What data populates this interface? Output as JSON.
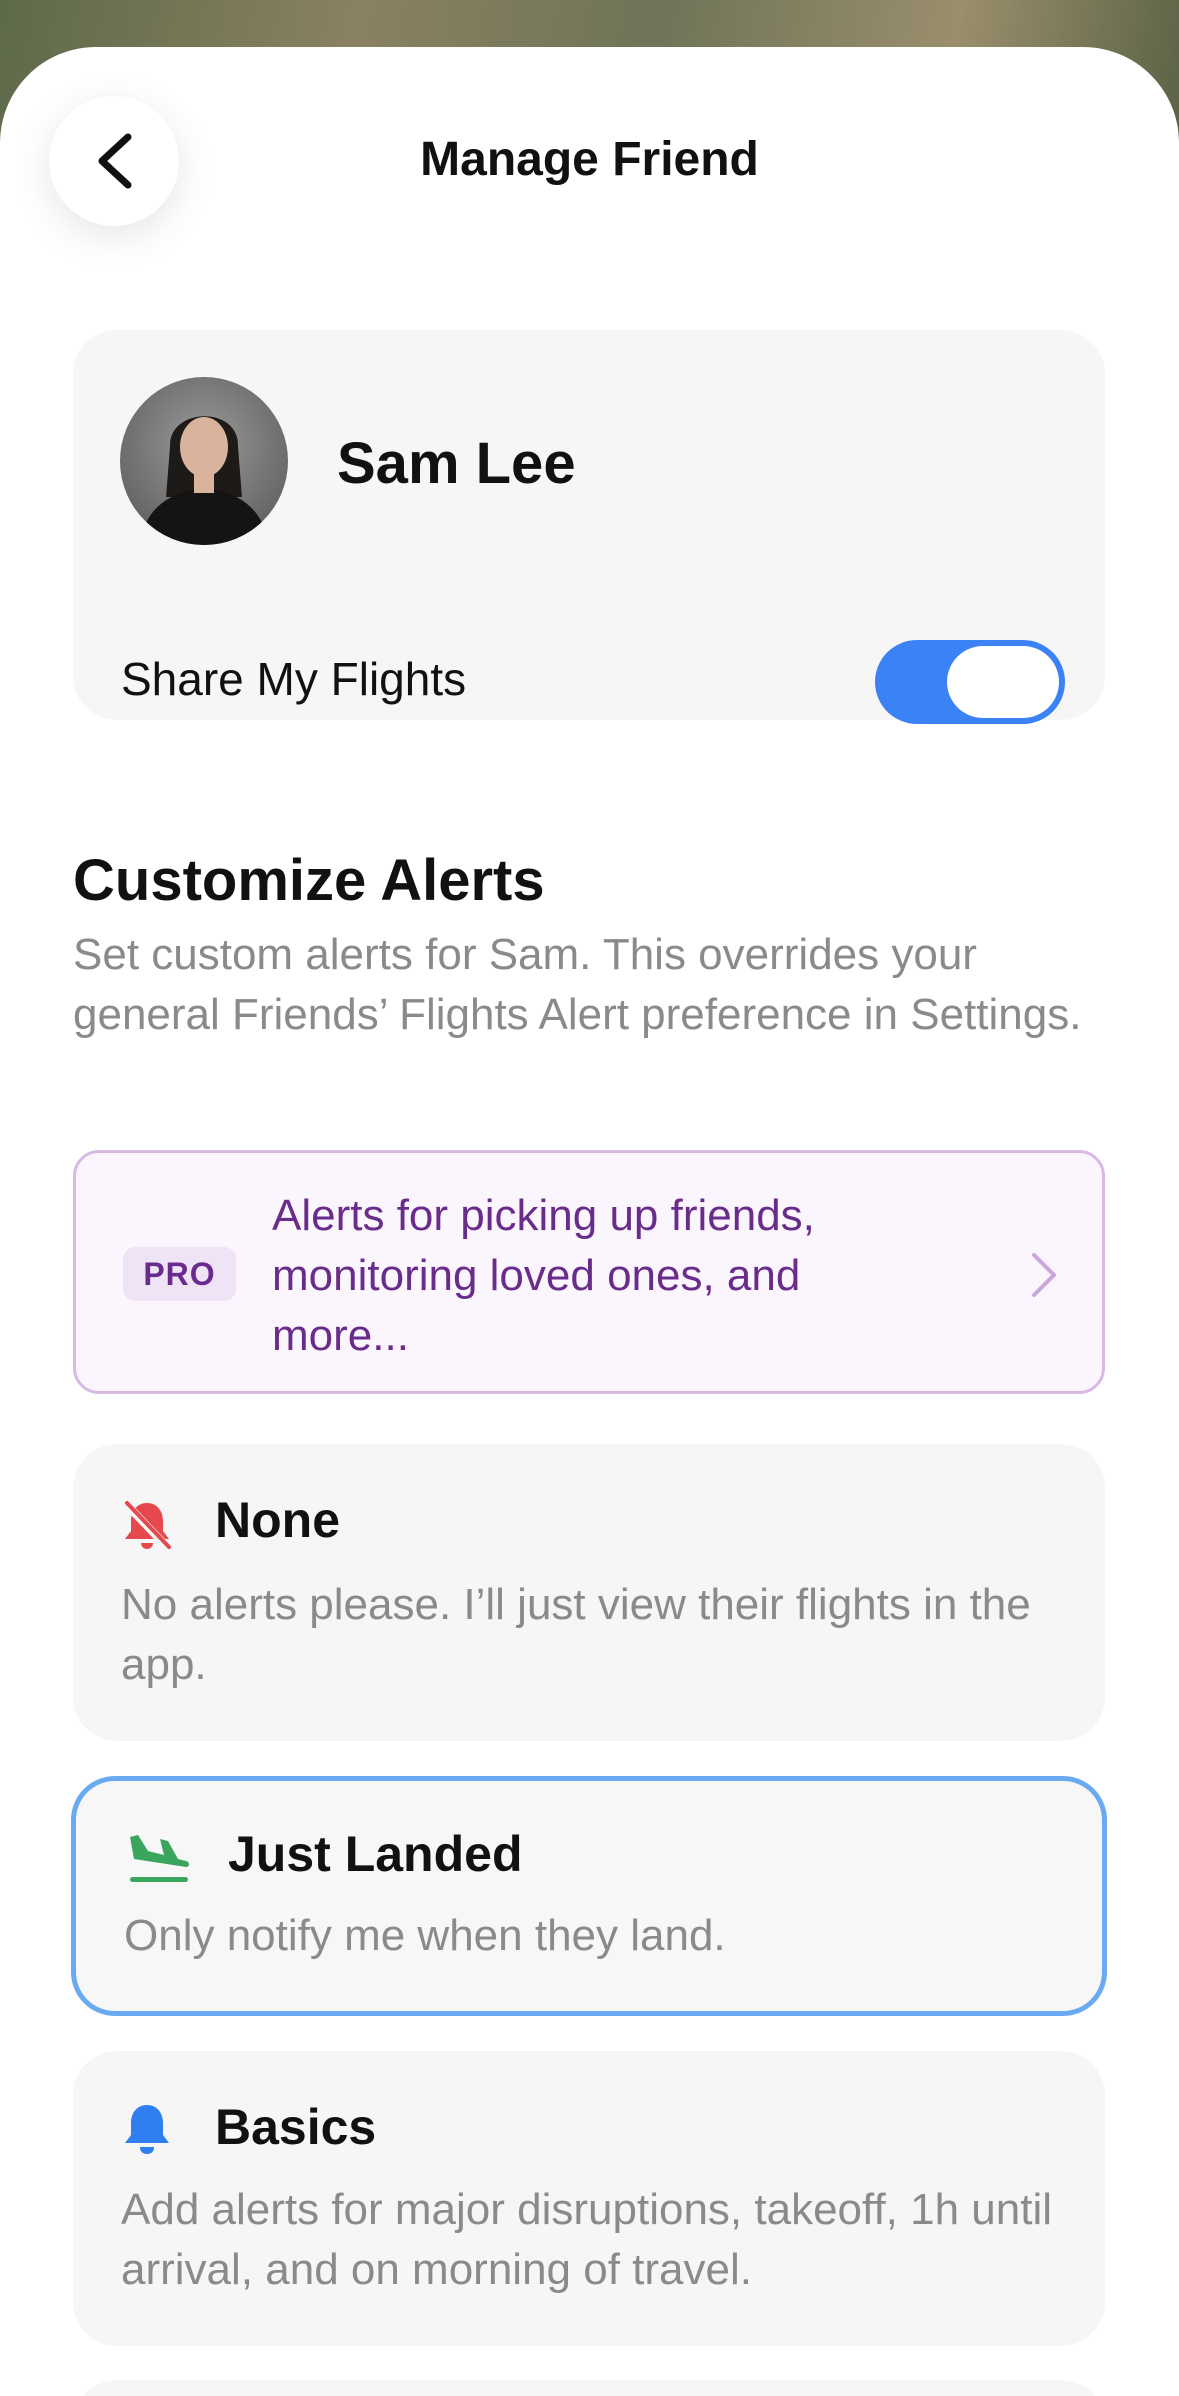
{
  "header": {
    "title": "Manage Friend"
  },
  "friend": {
    "name": "Sam Lee"
  },
  "share": {
    "label": "Share My Flights",
    "enabled": true
  },
  "alerts": {
    "title": "Customize Alerts",
    "description": "Set custom alerts for Sam. This overrides your general Friends’ Flights Alert preference in Settings."
  },
  "pro": {
    "badge": "PRO",
    "text": "Alerts for picking up friends, monitoring loved ones, and more..."
  },
  "options": [
    {
      "title": "None",
      "description": "No alerts please. I’ll just view their flights in the app.",
      "icon": "bell-slash-icon",
      "color": "#e5484d"
    },
    {
      "title": "Just Landed",
      "description": "Only notify me when they land.",
      "icon": "plane-landing-icon",
      "color": "#3aa55d",
      "selected": true
    },
    {
      "title": "Basics",
      "description": "Add alerts for major disruptions, takeoff, 1h until arrival, and on morning of travel.",
      "icon": "bell-icon",
      "color": "#2f7ff0"
    }
  ],
  "colors": {
    "accent": "#3b82f6",
    "pro_purple": "#6a2c8a",
    "selected_border": "#6aaaf0"
  }
}
